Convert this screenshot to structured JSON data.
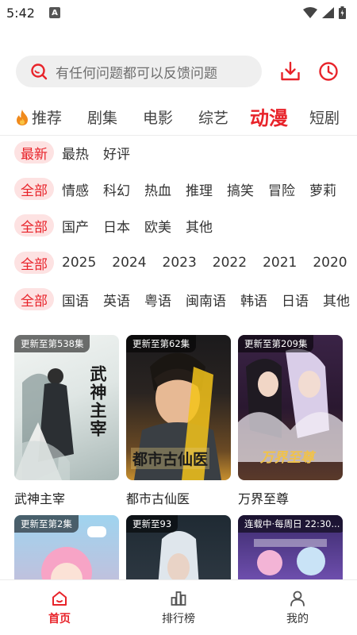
{
  "status_bar": {
    "time": "5:42",
    "notification_letter": "A"
  },
  "search": {
    "placeholder": "有任何问题都可以反馈问题"
  },
  "category_tabs": [
    {
      "label": "推荐"
    },
    {
      "label": "剧集"
    },
    {
      "label": "电影"
    },
    {
      "label": "综艺"
    },
    {
      "label": "动漫",
      "active": true
    },
    {
      "label": "短剧"
    }
  ],
  "filters": {
    "sort": {
      "active": "最新",
      "options": [
        "最热",
        "好评"
      ]
    },
    "genre": {
      "active": "全部",
      "options": [
        "情感",
        "科幻",
        "热血",
        "推理",
        "搞笑",
        "冒险",
        "萝莉"
      ]
    },
    "region": {
      "active": "全部",
      "options": [
        "国产",
        "日本",
        "欧美",
        "其他"
      ]
    },
    "year": {
      "active": "全部",
      "options": [
        "2025",
        "2024",
        "2023",
        "2022",
        "2021",
        "2020"
      ]
    },
    "language": {
      "active": "全部",
      "options": [
        "国语",
        "英语",
        "粤语",
        "闽南语",
        "韩语",
        "日语",
        "其他"
      ]
    }
  },
  "shows": [
    {
      "title": "武神主宰",
      "badge": "更新至第538集",
      "poster_text": "武神主宰"
    },
    {
      "title": "都市古仙医",
      "badge": "更新至第62集",
      "poster_text": "都市古仙医"
    },
    {
      "title": "万界至尊",
      "badge": "更新至第209集",
      "poster_text": "万界至尊"
    },
    {
      "title": "",
      "badge": "更新至第2集",
      "poster_text": ""
    },
    {
      "title": "",
      "badge": "更新至93",
      "poster_text": ""
    },
    {
      "title": "",
      "badge": "连载中·每周日 22:30...",
      "poster_text": ""
    }
  ],
  "bottom_nav": [
    {
      "label": "首页",
      "icon": "home-icon",
      "active": true
    },
    {
      "label": "排行榜",
      "icon": "ranking-icon"
    },
    {
      "label": "我的",
      "icon": "profile-icon"
    }
  ],
  "colors": {
    "accent": "#e8232a",
    "chip_bg": "#fde2e2",
    "search_bg": "#efefef"
  }
}
